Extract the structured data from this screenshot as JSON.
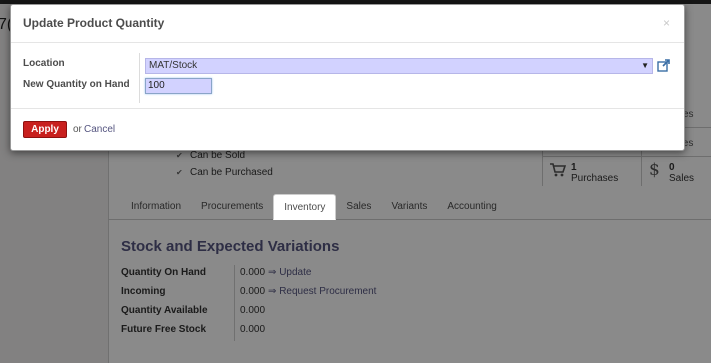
{
  "background": {
    "left_title_fragment": "7(",
    "smart_buttons": {
      "purchases_count": "1",
      "purchases_label": "Purchases",
      "sales_count": "0",
      "sales_label": "Sales",
      "partial_top": "ves",
      "partial_mid": "tes"
    },
    "checkboxes": [
      {
        "label": "Can be Sold",
        "checked": true
      },
      {
        "label": "Can be Purchased",
        "checked": true
      }
    ],
    "tabs": [
      {
        "label": "Information",
        "active": false
      },
      {
        "label": "Procurements",
        "active": false
      },
      {
        "label": "Inventory",
        "active": true
      },
      {
        "label": "Sales",
        "active": false
      },
      {
        "label": "Variants",
        "active": false
      },
      {
        "label": "Accounting",
        "active": false
      }
    ],
    "section_title": "Stock and Expected Variations",
    "fields": [
      {
        "label": "Quantity On Hand",
        "value": "0.000",
        "link": "⇒ Update"
      },
      {
        "label": "Incoming",
        "value": "0.000",
        "link": "⇒ Request Procurement"
      },
      {
        "label": "Quantity Available",
        "value": "0.000",
        "link": ""
      },
      {
        "label": "Future Free Stock",
        "value": "0.000",
        "link": ""
      }
    ]
  },
  "modal": {
    "title": "Update Product Quantity",
    "close_glyph": "×",
    "location_label": "Location",
    "location_value": "MAT/Stock",
    "quantity_label": "New Quantity on Hand",
    "quantity_value": "100",
    "apply_label": "Apply",
    "or_text": "or",
    "cancel_label": "Cancel"
  },
  "colors": {
    "apply": "#c8201e",
    "link": "#555580",
    "field_bg": "#d2d2ff"
  }
}
